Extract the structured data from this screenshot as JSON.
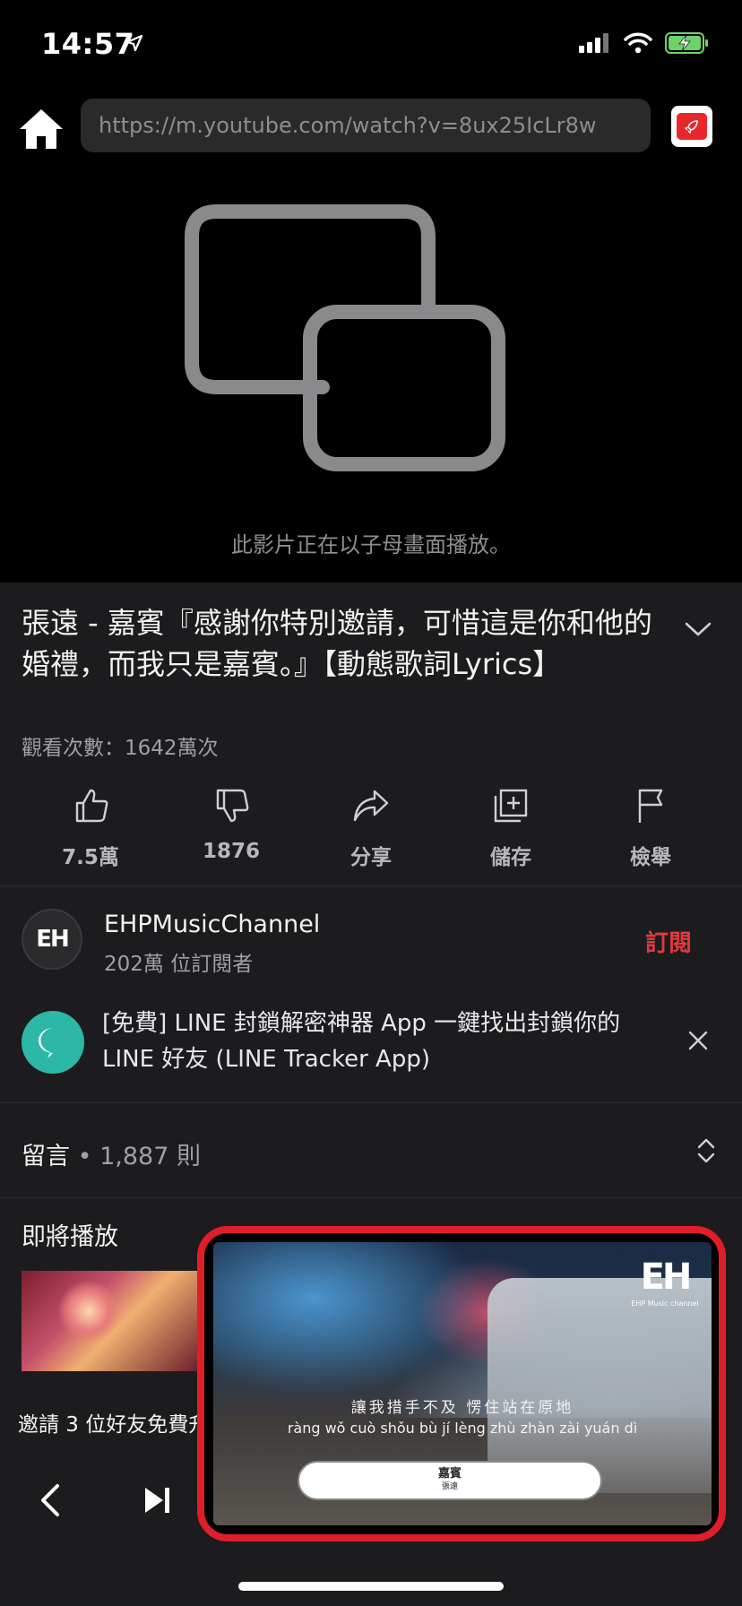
{
  "status_bar": {
    "time": "14:57"
  },
  "browser": {
    "url": "https://m.youtube.com/watch?v=8ux25IcLr8w"
  },
  "player": {
    "pip_message": "此影片正在以子母畫面播放。"
  },
  "video": {
    "title": "張遠 - 嘉賓『感謝你特別邀請，可惜這是你和他的婚禮，而我只是嘉賓。』【動態歌詞Lyrics】",
    "views": "觀看次數：1642萬次"
  },
  "actions": {
    "like": "7.5萬",
    "dislike": "1876",
    "share": "分享",
    "save": "儲存",
    "report": "檢舉"
  },
  "channel": {
    "avatar_text": "EH",
    "name": "EHPMusicChannel",
    "subscribers": "202萬 位訂閱者",
    "subscribe_label": "訂閱"
  },
  "ad": {
    "text": "[免費] LINE 封鎖解密神器 App 一鍵找出封鎖你的LINE 好友 (LINE Tracker App)"
  },
  "comments": {
    "label": "留言",
    "count": " • 1,887 則"
  },
  "up_next": {
    "label": "即將播放"
  },
  "bottom": {
    "invite_text": "邀請 3 位好友免費升"
  },
  "pip": {
    "logo": "EH",
    "logo_sub": "EHP Music channel",
    "lyric_cn": "讓我措手不及 愣住站在原地",
    "lyric_pinyin": "ràng wǒ cuò shǒu bù jí lèng zhù zhàn zài yuán dì",
    "song_title": "嘉賓",
    "song_artist": "張遠"
  },
  "colors": {
    "accent": "#e0393e",
    "pip_border": "#e01e28",
    "background": "#1c1c1e"
  }
}
